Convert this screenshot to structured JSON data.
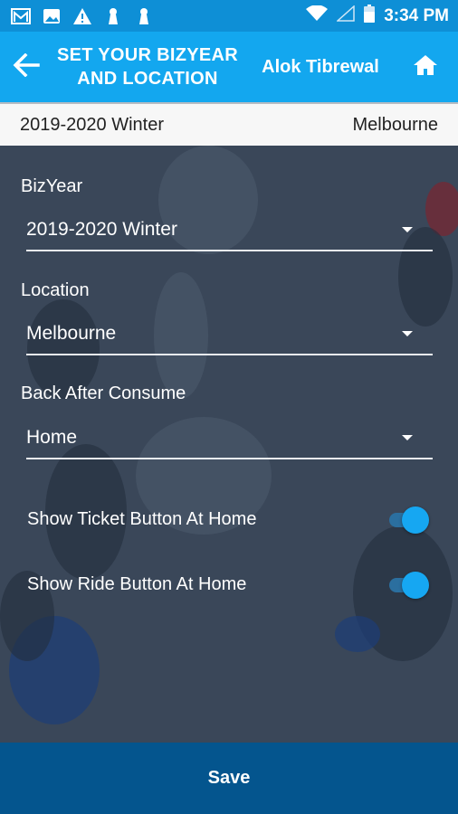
{
  "status_bar": {
    "time": "3:34 PM",
    "left_icons": [
      "gmail-icon",
      "image-icon",
      "warning-icon",
      "keyhole-icon",
      "keyhole-icon"
    ],
    "right_icons": [
      "wifi-icon",
      "signal-icon",
      "battery-icon"
    ]
  },
  "header": {
    "title_line1": "SET YOUR BIZYEAR",
    "title_line2": "AND LOCATION",
    "user_name": "Alok Tibrewal",
    "back_icon": "back-arrow-icon",
    "home_icon": "home-icon"
  },
  "summary": {
    "bizyear": "2019-2020 Winter",
    "location": "Melbourne"
  },
  "form": {
    "bizyear": {
      "label": "BizYear",
      "value": "2019-2020 Winter"
    },
    "location": {
      "label": "Location",
      "value": "Melbourne"
    },
    "back_after_consume": {
      "label": "Back After Consume",
      "value": "Home"
    },
    "toggles": [
      {
        "label": "Show Ticket Button At Home",
        "on": true
      },
      {
        "label": "Show Ride Button At Home",
        "on": true
      }
    ]
  },
  "save": {
    "label": "Save"
  },
  "colors": {
    "status_bar": "#0e8fd6",
    "header": "#13a7ef",
    "save_bar": "#04558e",
    "toggle_on": "#16a7f2"
  }
}
